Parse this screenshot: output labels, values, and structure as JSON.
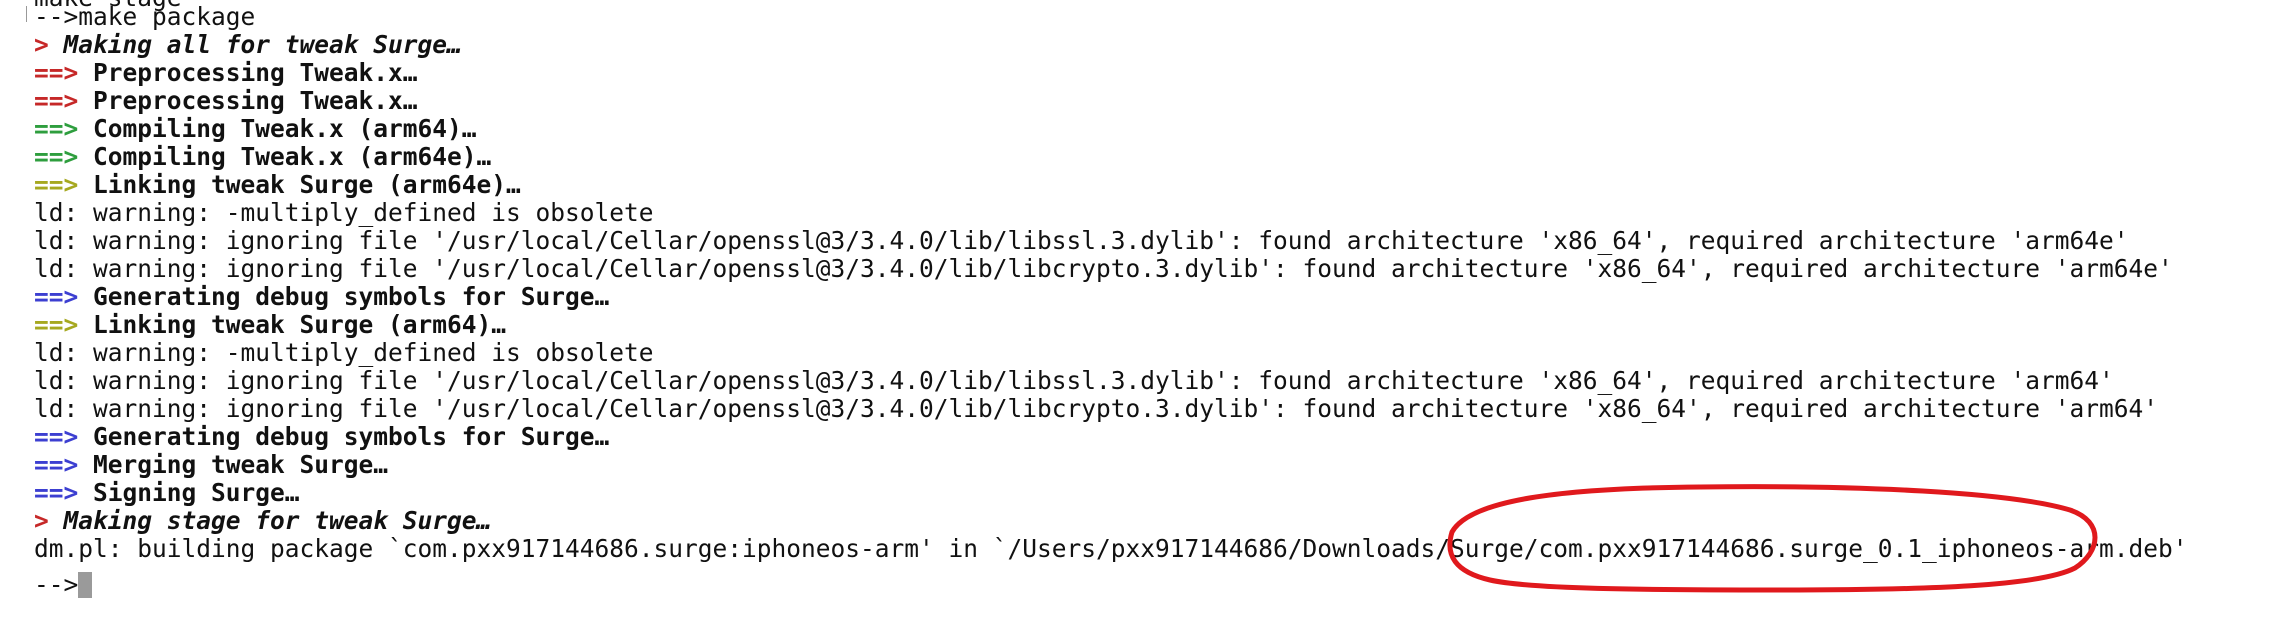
{
  "terminal": {
    "previous_line": "make stage",
    "prompt": "-->",
    "command": "make package",
    "lines": [
      {
        "arrow": ">",
        "arrow_color": "red",
        "text": "Making all for tweak Surge…",
        "style": "bold-italic"
      },
      {
        "arrow": "==>",
        "arrow_color": "red",
        "text": "Preprocessing Tweak.x…",
        "style": "bold"
      },
      {
        "arrow": "==>",
        "arrow_color": "red",
        "text": "Preprocessing Tweak.x…",
        "style": "bold"
      },
      {
        "arrow": "==>",
        "arrow_color": "green",
        "text": "Compiling Tweak.x (arm64)…",
        "style": "bold"
      },
      {
        "arrow": "==>",
        "arrow_color": "green",
        "text": "Compiling Tweak.x (arm64e)…",
        "style": "bold"
      },
      {
        "arrow": "==>",
        "arrow_color": "olive",
        "text": "Linking tweak Surge (arm64e)…",
        "style": "bold"
      },
      {
        "arrow": "",
        "arrow_color": "",
        "text": "ld: warning: -multiply_defined is obsolete",
        "style": "plain"
      },
      {
        "arrow": "",
        "arrow_color": "",
        "text": "ld: warning: ignoring file '/usr/local/Cellar/openssl@3/3.4.0/lib/libssl.3.dylib': found architecture 'x86_64', required architecture 'arm64e'",
        "style": "plain"
      },
      {
        "arrow": "",
        "arrow_color": "",
        "text": "ld: warning: ignoring file '/usr/local/Cellar/openssl@3/3.4.0/lib/libcrypto.3.dylib': found architecture 'x86_64', required architecture 'arm64e'",
        "style": "plain"
      },
      {
        "arrow": "==>",
        "arrow_color": "blue",
        "text": "Generating debug symbols for Surge…",
        "style": "bold"
      },
      {
        "arrow": "==>",
        "arrow_color": "olive",
        "text": "Linking tweak Surge (arm64)…",
        "style": "bold"
      },
      {
        "arrow": "",
        "arrow_color": "",
        "text": "ld: warning: -multiply_defined is obsolete",
        "style": "plain"
      },
      {
        "arrow": "",
        "arrow_color": "",
        "text": "ld: warning: ignoring file '/usr/local/Cellar/openssl@3/3.4.0/lib/libssl.3.dylib': found architecture 'x86_64', required architecture 'arm64'",
        "style": "plain"
      },
      {
        "arrow": "",
        "arrow_color": "",
        "text": "ld: warning: ignoring file '/usr/local/Cellar/openssl@3/3.4.0/lib/libcrypto.3.dylib': found architecture 'x86_64', required architecture 'arm64'",
        "style": "plain"
      },
      {
        "arrow": "==>",
        "arrow_color": "blue",
        "text": "Generating debug symbols for Surge…",
        "style": "bold"
      },
      {
        "arrow": "==>",
        "arrow_color": "blue",
        "text": "Merging tweak Surge…",
        "style": "bold"
      },
      {
        "arrow": "==>",
        "arrow_color": "blue",
        "text": "Signing Surge…",
        "style": "bold"
      },
      {
        "arrow": ">",
        "arrow_color": "red",
        "text": "Making stage for tweak Surge…",
        "style": "bold-italic"
      },
      {
        "arrow": "",
        "arrow_color": "",
        "text": "dm.pl: building package `com.pxx917144686.surge:iphoneos-arm' in `/Users/pxx917144686/Downloads/Surge/com.pxx917144686.surge_0.1_iphoneos-arm.deb'",
        "style": "plain"
      }
    ],
    "final_prompt": "-->"
  },
  "colors": {
    "background": "#ffffff",
    "text": "#111111",
    "arrow_red": "#c62828",
    "arrow_green": "#2e9e3e",
    "arrow_olive": "#a6a820",
    "arrow_blue": "#3c3fd1",
    "cursor": "#9a9a9a",
    "annotation_circle": "#e0191d"
  }
}
